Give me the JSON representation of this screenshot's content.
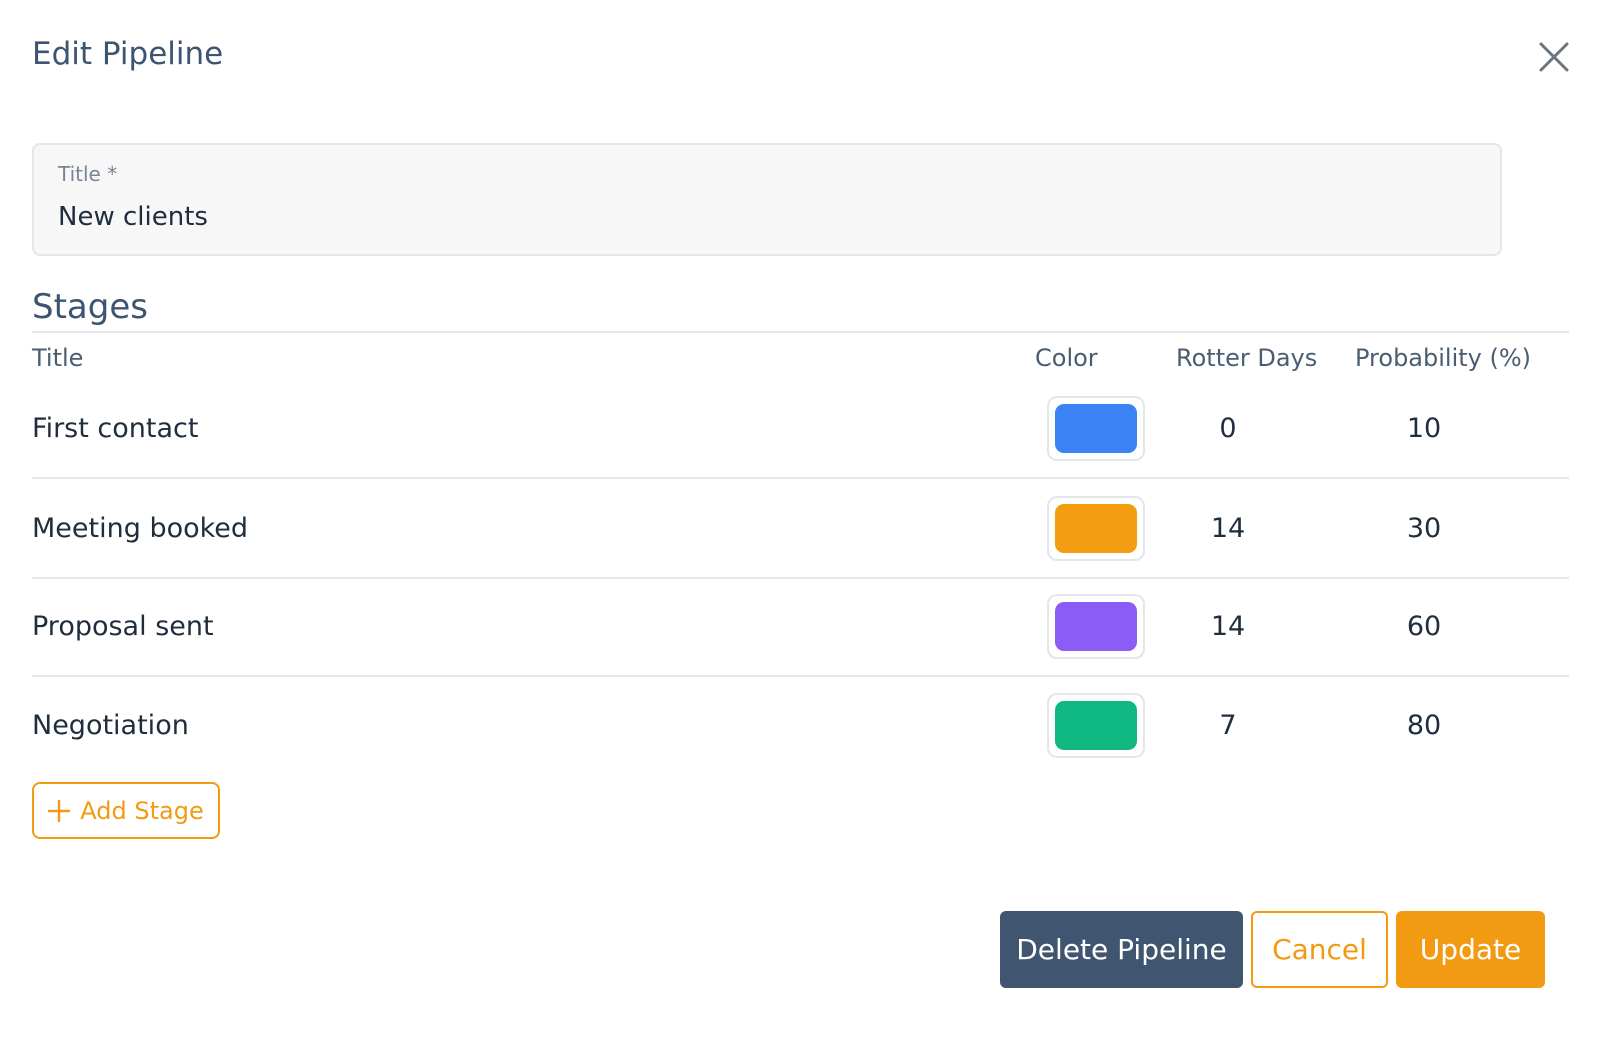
{
  "dialog": {
    "title": "Edit Pipeline",
    "close_icon": "close-icon"
  },
  "title_field": {
    "label": "Title *",
    "value": "New clients"
  },
  "stages": {
    "heading": "Stages",
    "columns": {
      "title": "Title",
      "color": "Color",
      "rotter_days": "Rotter Days",
      "probability": "Probability (%)"
    },
    "rows": [
      {
        "title": "First contact",
        "color": "#3b82f6",
        "rotter_days": "0",
        "probability": "10"
      },
      {
        "title": "Meeting booked",
        "color": "#f39c0f",
        "rotter_days": "14",
        "probability": "30"
      },
      {
        "title": "Proposal sent",
        "color": "#8b5cf6",
        "rotter_days": "14",
        "probability": "60"
      },
      {
        "title": "Negotiation",
        "color": "#10b981",
        "rotter_days": "7",
        "probability": "80"
      }
    ],
    "add_stage_label": "Add Stage",
    "add_icon": "plus-icon"
  },
  "footer": {
    "delete_label": "Delete Pipeline",
    "cancel_label": "Cancel",
    "update_label": "Update"
  },
  "colors": {
    "accent": "#f29a12",
    "primary_dark": "#3f5570",
    "heading": "#3d5570"
  }
}
